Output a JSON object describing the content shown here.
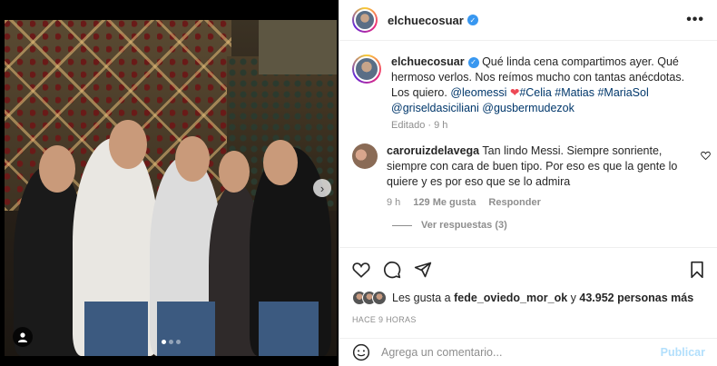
{
  "post": {
    "username": "elchuecosuar",
    "more_label": "•••"
  },
  "caption": {
    "username": "elchuecosuar",
    "text_part1": "Qué linda cena compartimos ayer. Qué hermoso verlos. Nos reímos mucho con tantas anécdotas. Los quiero.",
    "mention1": "@leomessi",
    "heart": "❤",
    "tags": "#Celia #Matias #MariaSol",
    "mention2": "@griseldasiciliani",
    "mention3": "@gusbermudezok",
    "meta": "Editado · 9 h"
  },
  "comment": {
    "username": "caroruizdelavega",
    "text": "Tan lindo Messi. Siempre sonriente, siempre con cara de buen tipo. Por eso es que la gente lo quiere y es por eso que se lo admira",
    "time": "9 h",
    "likes": "129 Me gusta",
    "reply_label": "Responder",
    "view_replies": "Ver respuestas (3)"
  },
  "likes": {
    "prefix": "Les gusta a",
    "user": "fede_oviedo_mor_ok",
    "connector": "y",
    "count": "43.952 personas más"
  },
  "timestamp": "HACE 9 HORAS",
  "add_comment": {
    "placeholder": "Agrega un comentario...",
    "publish_label": "Publicar"
  },
  "carousel": {
    "total_slides": 3,
    "current_slide": 1
  },
  "colors": {
    "link": "#00376b",
    "verified": "#3897f0",
    "muted": "#8e8e8e",
    "heart": "#ed4956",
    "publish_disabled": "#b2dffc"
  }
}
